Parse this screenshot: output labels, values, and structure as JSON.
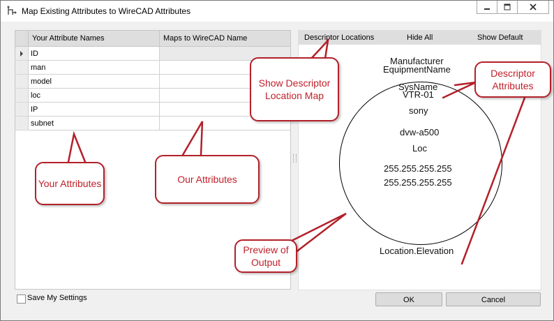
{
  "window": {
    "title": "Map Existing Attributes to WireCAD Attributes"
  },
  "grid": {
    "columns": [
      "Your Attribute Names",
      "Maps to WireCAD Name"
    ],
    "rows": [
      {
        "name": "ID",
        "map": ""
      },
      {
        "name": "man",
        "map": ""
      },
      {
        "name": "model",
        "map": ""
      },
      {
        "name": "loc",
        "map": ""
      },
      {
        "name": "IP",
        "map": ""
      },
      {
        "name": "subnet",
        "map": ""
      }
    ]
  },
  "preview": {
    "toolbar": {
      "descriptor_locations": "Descriptor Locations",
      "hide_all": "Hide All",
      "show_default": "Show Default"
    },
    "labels": {
      "manufacturer": "Manufacturer",
      "equipment_name": "EquipmentName",
      "sys_name": "SysName",
      "vtr": "VTR-01",
      "sony": "sony",
      "model": "dvw-a500",
      "loc": "Loc",
      "ip": "255.255.255.255",
      "subnet": "255.255.255.255",
      "location_elevation": "Location.Elevation"
    }
  },
  "footer": {
    "save_settings": "Save My Settings",
    "ok": "OK",
    "cancel": "Cancel"
  },
  "callouts": {
    "show_map": "Show Descriptor Location Map",
    "descriptor_attributes": "Descriptor Attributes",
    "your_attributes": "Your Attributes",
    "our_attributes": "Our Attributes",
    "preview_output": "Preview of Output"
  },
  "colors": {
    "callout_border": "#b3202a",
    "callout_text": "#c0202a",
    "grid_header": "#dedede"
  }
}
